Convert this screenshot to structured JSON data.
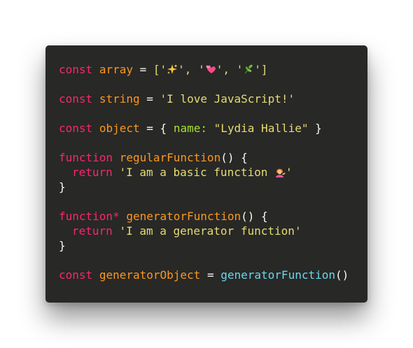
{
  "code": {
    "line1": {
      "kw": "const",
      "name": "array",
      "op": "=",
      "open": "['",
      "sep1": "', '",
      "sep2": "', '",
      "close": "']",
      "emojis": [
        "sparkles-emoji",
        "two-hearts-emoji",
        "herb-emoji"
      ]
    },
    "line2": {
      "kw": "const",
      "name": "string",
      "op": "=",
      "value": "'I love JavaScript!'"
    },
    "line3": {
      "kw": "const",
      "name": "object",
      "op": "=",
      "open": "{",
      "key": "name:",
      "value": "\"Lydia Hallie\"",
      "close": "}"
    },
    "line4": {
      "kw": "function",
      "name": "regularFunction",
      "parens": "()",
      "brace": "{"
    },
    "line5": {
      "kw": "return",
      "value_start": "'I am a basic function ",
      "value_end": "'",
      "emoji": "person-tipping-hand-emoji"
    },
    "line6": {
      "brace": "}"
    },
    "line7": {
      "kw": "function*",
      "name": "generatorFunction",
      "parens": "()",
      "brace": "{"
    },
    "line8": {
      "kw": "return",
      "value": "'I am a generator function'"
    },
    "line9": {
      "brace": "}"
    },
    "line10": {
      "kw": "const",
      "name": "generatorObject",
      "op": "=",
      "call": "generatorFunction",
      "parens": "()"
    }
  },
  "colors": {
    "background": "#282826",
    "keyword": "#f92672",
    "identifier": "#fd971f",
    "string": "#e6db74",
    "property": "#a6e22e",
    "call": "#66d9ef",
    "punctuation": "#f8f8f2"
  }
}
